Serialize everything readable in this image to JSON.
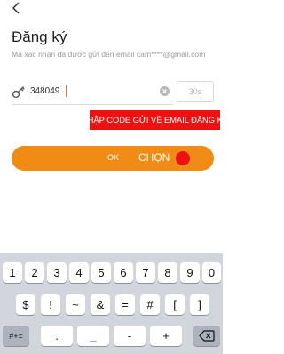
{
  "header": {
    "back_icon": "chevron-left-icon"
  },
  "title": "Đăng ký",
  "subtitle": "Mã xác nhận đã được gửi đến email cam****@gmail.com",
  "code_input": {
    "value": "348049",
    "key_icon": "key-icon",
    "clear_icon": "clear-icon"
  },
  "countdown": "30s",
  "annotation": "NHẬP CODE GỬI VỀ EMAIL ĐĂNG KÝ",
  "ok_button": {
    "label": "OK",
    "annotation": "CHỌN"
  },
  "colors": {
    "accent": "#f08c16",
    "annotation_red": "#ee1111"
  },
  "keyboard": {
    "row1": [
      "1",
      "2",
      "3",
      "4",
      "5",
      "6",
      "7",
      "8",
      "9",
      "0"
    ],
    "row2": [
      "$",
      "!",
      "~",
      "&",
      "=",
      "#",
      "[",
      "]"
    ],
    "row3_left": "#+=",
    "row3": [
      ".",
      "_",
      "-",
      "+"
    ],
    "row3_right": "backspace-icon"
  }
}
